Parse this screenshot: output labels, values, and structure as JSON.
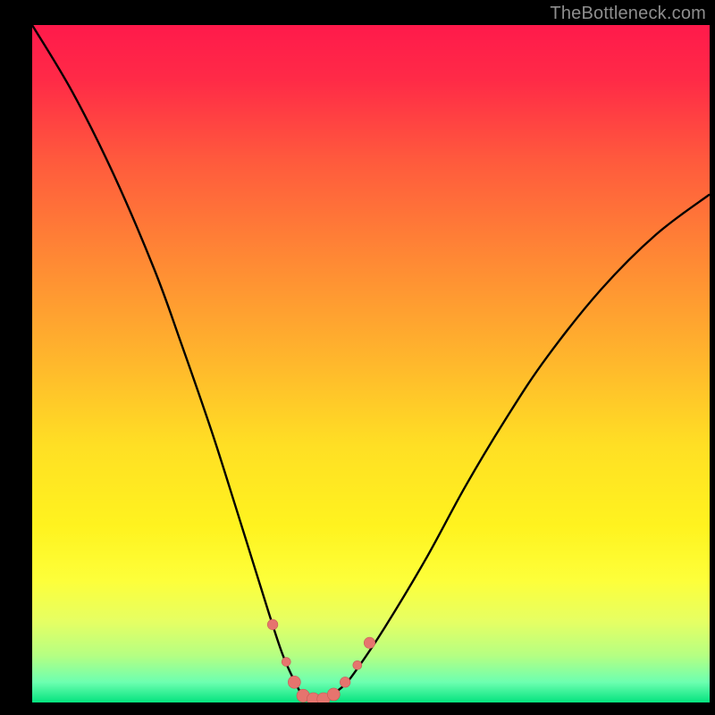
{
  "watermark": "TheBottleneck.com",
  "colors": {
    "page_bg": "#000000",
    "watermark_text": "#8e8e8e",
    "curve": "#000000",
    "marker_fill": "#e6746e",
    "marker_stroke": "#c55a55",
    "gradient_stops": [
      {
        "offset": 0.0,
        "color": "#ff1a4b"
      },
      {
        "offset": 0.08,
        "color": "#ff2a47"
      },
      {
        "offset": 0.2,
        "color": "#ff5a3d"
      },
      {
        "offset": 0.35,
        "color": "#ff8a34"
      },
      {
        "offset": 0.5,
        "color": "#ffb82c"
      },
      {
        "offset": 0.62,
        "color": "#ffdf24"
      },
      {
        "offset": 0.74,
        "color": "#fff31f"
      },
      {
        "offset": 0.82,
        "color": "#fdff3a"
      },
      {
        "offset": 0.88,
        "color": "#e6ff63"
      },
      {
        "offset": 0.93,
        "color": "#b6ff82"
      },
      {
        "offset": 0.97,
        "color": "#6dffb0"
      },
      {
        "offset": 1.0,
        "color": "#05e37f"
      }
    ]
  },
  "chart_data": {
    "type": "line",
    "title": "",
    "xlabel": "",
    "ylabel": "",
    "xlim": [
      0,
      100
    ],
    "ylim": [
      0,
      100
    ],
    "grid": false,
    "legend": "none",
    "series": [
      {
        "name": "bottleneck-curve",
        "x": [
          0,
          6,
          12,
          18,
          22,
          26.5,
          30,
          32.5,
          35,
          37,
          38.8,
          40,
          41.2,
          43,
          44,
          46,
          48,
          52,
          58,
          64,
          70,
          76,
          84,
          92,
          100
        ],
        "values": [
          100,
          90,
          78,
          64,
          53,
          40,
          29,
          21,
          13,
          7,
          3,
          1,
          0.5,
          0.5,
          1,
          2.5,
          5,
          11,
          21,
          32,
          42,
          51,
          61,
          69,
          75
        ]
      }
    ],
    "markers": {
      "name": "highlight-points",
      "x": [
        35.5,
        37.5,
        38.7,
        40.0,
        41.5,
        43.0,
        44.5,
        46.2,
        48.0,
        49.8
      ],
      "values": [
        11.5,
        6.0,
        3.0,
        1.0,
        0.5,
        0.5,
        1.2,
        3.0,
        5.5,
        8.8
      ],
      "radius": [
        5.8,
        5.0,
        7.0,
        7.2,
        7.2,
        7.2,
        7.0,
        5.8,
        5.0,
        6.2
      ]
    }
  }
}
